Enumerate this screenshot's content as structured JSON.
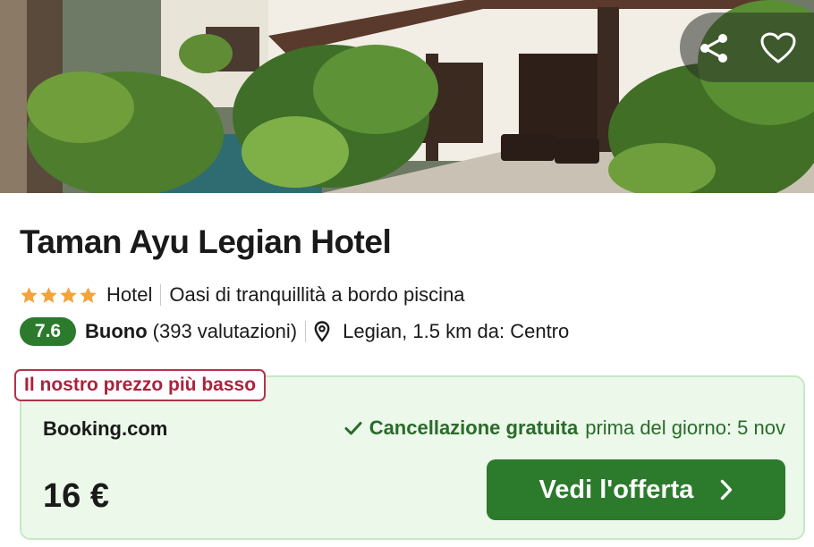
{
  "hotel": {
    "name": "Taman Ayu Legian Hotel",
    "stars": 4,
    "type": "Hotel",
    "tagline": "Oasi di tranquillità a bordo piscina"
  },
  "rating": {
    "score": "7.6",
    "label": "Buono",
    "reviews": "(393 valutazioni)"
  },
  "location": {
    "text": "Legian, 1.5 km da: Centro"
  },
  "offer": {
    "badge": "Il nostro prezzo più basso",
    "provider": "Booking.com",
    "cancellation_strong": "Cancellazione gratuita",
    "cancellation_rest": "prima del giorno: 5 nov",
    "price": "16 €",
    "cta_label": "Vedi l'offerta"
  },
  "icons": {
    "share": "share-icon",
    "favorite": "heart-icon",
    "star": "star-icon",
    "location": "map-pin-icon",
    "check": "check-icon",
    "chevron": "chevron-right-icon"
  },
  "colors": {
    "accent_green": "#2c7a2c",
    "offer_bg": "#ebf8ea",
    "badge_red": "#a8243c",
    "star_orange": "#f3a33a"
  }
}
